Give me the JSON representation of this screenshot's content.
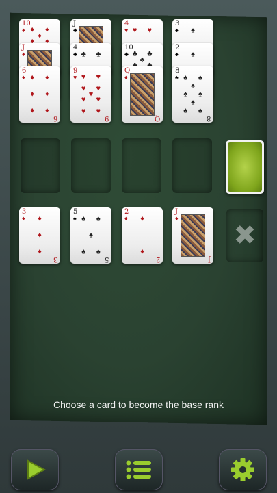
{
  "status_message": "Choose a card to become the base rank",
  "foundation_columns": [
    {
      "cards": [
        {
          "rank": "10",
          "suit": "♦",
          "color": "red"
        },
        {
          "rank": "J",
          "suit": "♦",
          "color": "red"
        },
        {
          "rank": "6",
          "suit": "♦",
          "color": "red"
        }
      ]
    },
    {
      "cards": [
        {
          "rank": "J",
          "suit": "♣",
          "color": "black"
        },
        {
          "rank": "4",
          "suit": "♣",
          "color": "black"
        },
        {
          "rank": "9",
          "suit": "♥",
          "color": "red"
        }
      ]
    },
    {
      "cards": [
        {
          "rank": "4",
          "suit": "♥",
          "color": "red"
        },
        {
          "rank": "10",
          "suit": "♣",
          "color": "black"
        },
        {
          "rank": "Q",
          "suit": "♦",
          "color": "red"
        }
      ]
    },
    {
      "cards": [
        {
          "rank": "3",
          "suit": "♠",
          "color": "black"
        },
        {
          "rank": "2",
          "suit": "♠",
          "color": "black"
        },
        {
          "rank": "8",
          "suit": "♠",
          "color": "black"
        }
      ]
    }
  ],
  "tableau": [
    {
      "rank": "3",
      "suit": "♦",
      "color": "red"
    },
    {
      "rank": "5",
      "suit": "♠",
      "color": "black"
    },
    {
      "rank": "2",
      "suit": "♦",
      "color": "red"
    },
    {
      "rank": "J",
      "suit": "♦",
      "color": "red"
    }
  ],
  "deck": {
    "back_color": "#8bb51f"
  },
  "toolbar": {
    "play_icon": "play-icon",
    "menu_icon": "menu-list-icon",
    "settings_icon": "gear-icon"
  }
}
